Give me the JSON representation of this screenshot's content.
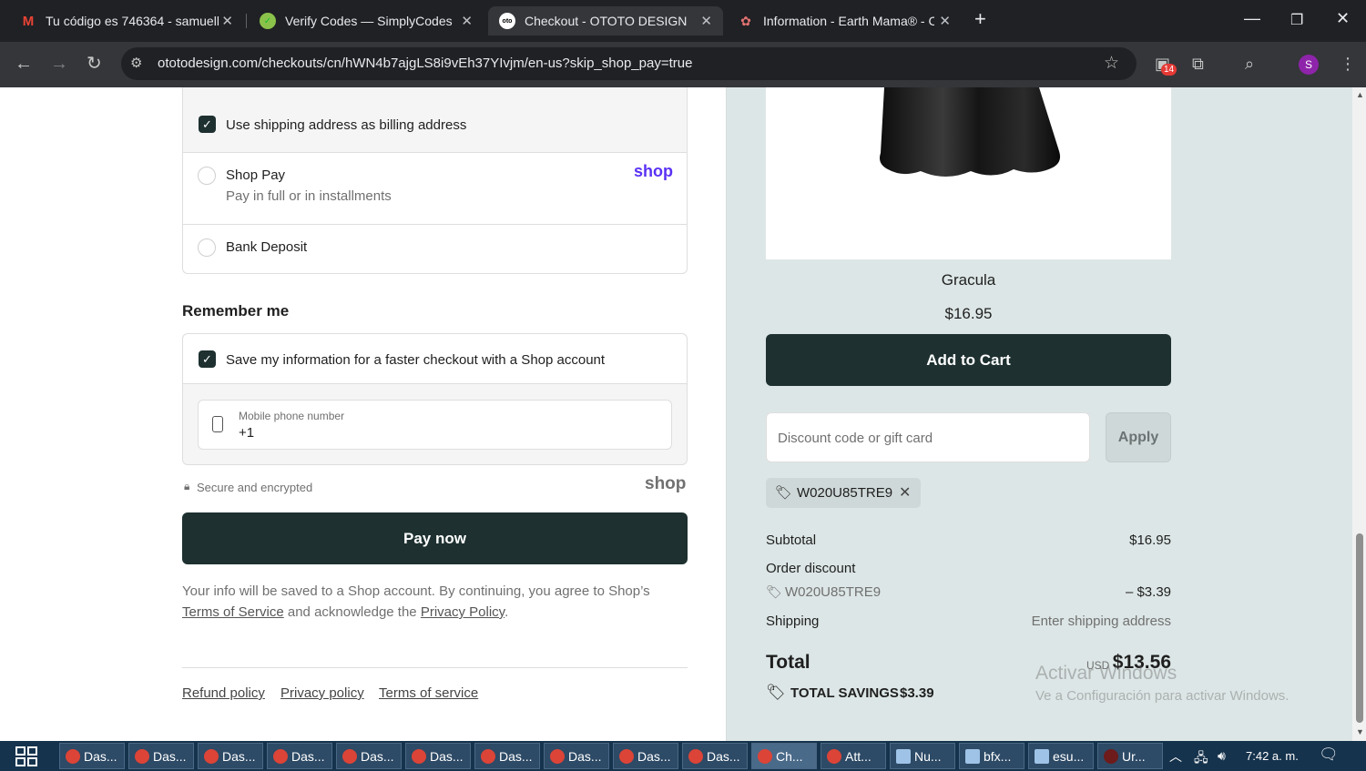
{
  "browser": {
    "tabs": [
      {
        "title": "Tu código es 746364 - samuellu",
        "icon": "gmail-icon"
      },
      {
        "title": "Verify Codes — SimplyCodes",
        "icon": "simplycodes-icon"
      },
      {
        "title": "Checkout - OTOTO DESIGN",
        "icon": "ototo-icon"
      },
      {
        "title": "Information - Earth Mama® - C",
        "icon": "earthmama-icon"
      }
    ],
    "url": "ototodesign.com/checkouts/cn/hWN4b7ajgLS8i9vEh37YIvjm/en-us?skip_shop_pay=true",
    "extensions_badge": "14",
    "profile_initial": "S"
  },
  "payment": {
    "billing_same_label": "Use shipping address as billing address",
    "shop_pay_label": "Shop Pay",
    "shop_pay_sub": "Pay in full or in installments",
    "shop_pay_logo": "shop",
    "bank_deposit_label": "Bank Deposit"
  },
  "remember": {
    "heading": "Remember me",
    "save_label": "Save my information for a faster checkout with a Shop account",
    "phone_label": "Mobile phone number",
    "phone_value": "+1"
  },
  "secure_text": "Secure and encrypted",
  "shop_logo": "shop",
  "pay_now": "Pay now",
  "consent": {
    "text1": "Your info will be saved to a Shop account. By continuing, you agree to Shop’s",
    "terms_link": "Terms of Service",
    "text2": " and acknowledge the ",
    "privacy_link": "Privacy Policy",
    "text3": "."
  },
  "footer_links": [
    "Refund policy",
    "Privacy policy",
    "Terms of service"
  ],
  "product": {
    "name": "Gracula",
    "price": "$16.95",
    "add_to_cart": "Add to Cart"
  },
  "discount": {
    "placeholder": "Discount code or gift card",
    "apply": "Apply",
    "code": "W020U85TRE9"
  },
  "summary": {
    "subtotal_label": "Subtotal",
    "subtotal_value": "$16.95",
    "order_discount_label": "Order discount",
    "discount_code": "W020U85TRE9",
    "discount_value": "– $3.39",
    "shipping_label": "Shipping",
    "shipping_value": "Enter shipping address",
    "total_label": "Total",
    "currency": "USD",
    "total_value": "$13.56",
    "savings_label": "TOTAL SAVINGS",
    "savings_value": "$3.39"
  },
  "watermark": {
    "title": "Activar Windows",
    "sub": "Ve a Configuración para activar Windows."
  },
  "taskbar": {
    "items": [
      {
        "label": "Das...",
        "icon": "chrome-icon"
      },
      {
        "label": "Das...",
        "icon": "chrome-icon"
      },
      {
        "label": "Das...",
        "icon": "chrome-icon"
      },
      {
        "label": "Das...",
        "icon": "chrome-icon"
      },
      {
        "label": "Das...",
        "icon": "chrome-icon"
      },
      {
        "label": "Das...",
        "icon": "chrome-icon"
      },
      {
        "label": "Das...",
        "icon": "chrome-icon"
      },
      {
        "label": "Das...",
        "icon": "chrome-icon"
      },
      {
        "label": "Das...",
        "icon": "chrome-icon"
      },
      {
        "label": "Das...",
        "icon": "chrome-icon"
      },
      {
        "label": "Ch...",
        "icon": "chrome-icon"
      },
      {
        "label": "Att...",
        "icon": "chrome-icon"
      },
      {
        "label": "Nu...",
        "icon": "notepad-icon"
      },
      {
        "label": "bfx...",
        "icon": "notepad-icon"
      },
      {
        "label": "esu...",
        "icon": "notepad-icon"
      },
      {
        "label": "Ur...",
        "icon": "app-icon"
      }
    ],
    "clock": "7:42 a. m."
  }
}
